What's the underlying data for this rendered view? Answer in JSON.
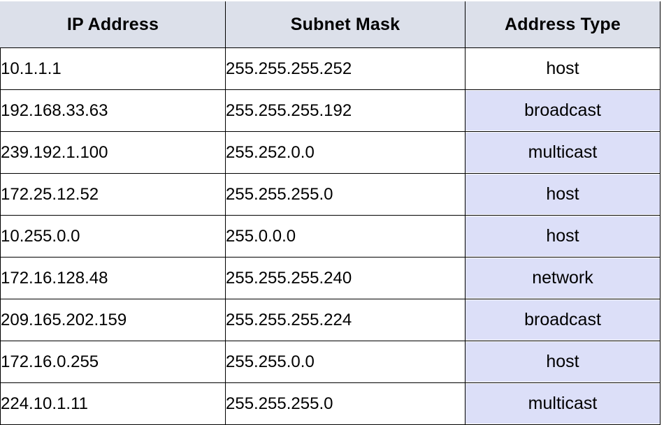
{
  "table": {
    "columns": [
      {
        "key": "ip",
        "label": "IP Address"
      },
      {
        "key": "mask",
        "label": "Subnet Mask"
      },
      {
        "key": "type",
        "label": "Address Type"
      }
    ],
    "header_bg": "#dce0ea",
    "type_cell_bg": "#dcdff8",
    "rows": [
      {
        "ip": "10.1.1.1",
        "mask": "255.255.255.252",
        "type": "host",
        "type_shaded": false
      },
      {
        "ip": "192.168.33.63",
        "mask": "255.255.255.192",
        "type": "broadcast",
        "type_shaded": true
      },
      {
        "ip": "239.192.1.100",
        "mask": "255.252.0.0",
        "type": "multicast",
        "type_shaded": true
      },
      {
        "ip": "172.25.12.52",
        "mask": "255.255.255.0",
        "type": "host",
        "type_shaded": true
      },
      {
        "ip": "10.255.0.0",
        "mask": "255.0.0.0",
        "type": "host",
        "type_shaded": true
      },
      {
        "ip": "172.16.128.48",
        "mask": "255.255.255.240",
        "type": "network",
        "type_shaded": true
      },
      {
        "ip": "209.165.202.159",
        "mask": "255.255.255.224",
        "type": "broadcast",
        "type_shaded": true
      },
      {
        "ip": "172.16.0.255",
        "mask": "255.255.0.0",
        "type": "host",
        "type_shaded": true
      },
      {
        "ip": "224.10.1.11",
        "mask": "255.255.255.0",
        "type": "multicast",
        "type_shaded": true
      }
    ]
  }
}
